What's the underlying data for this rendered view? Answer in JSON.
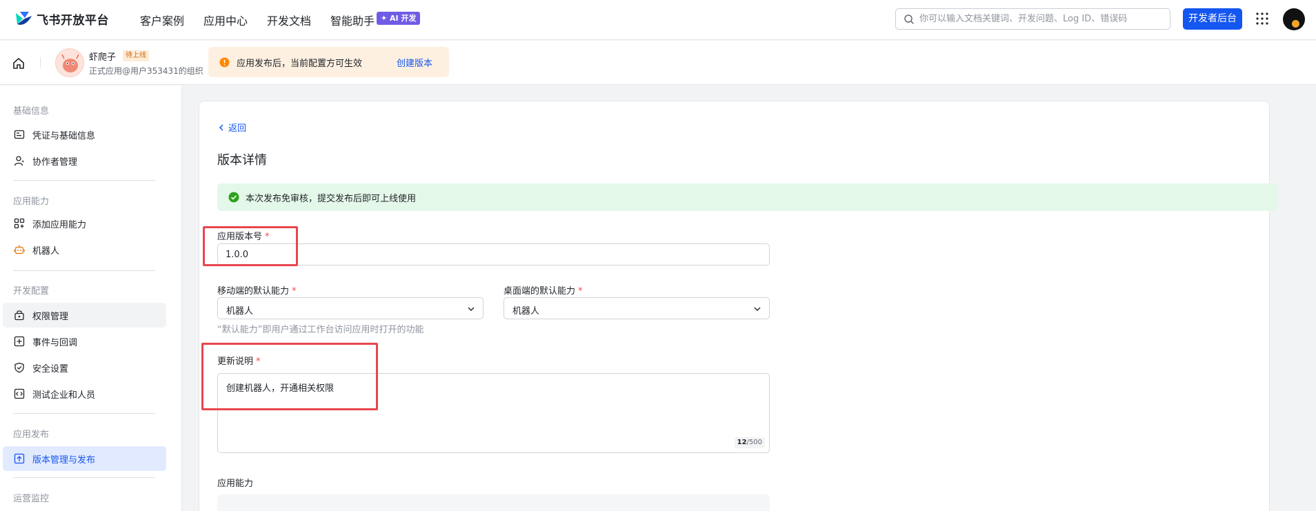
{
  "brand": {
    "name": "飞书开放平台"
  },
  "topnav": {
    "items": [
      {
        "label": "客户案例"
      },
      {
        "label": "应用中心"
      },
      {
        "label": "开发文档"
      },
      {
        "label": "智能助手"
      }
    ],
    "ai_badge": "✦ AI 开发",
    "search_placeholder": "你可以输入文档关键词、开发问题、Log ID、错误码",
    "dev_console_label": "开发者后台"
  },
  "app": {
    "name": "虾爬子",
    "status_badge": "待上线",
    "org": "正式应用@用户353431的组织"
  },
  "notice": {
    "text": "应用发布后，当前配置方可生效",
    "link": "创建版本"
  },
  "sidebar": {
    "groups": [
      {
        "title": "基础信息",
        "items": [
          {
            "label": "凭证与基础信息"
          },
          {
            "label": "协作者管理"
          }
        ]
      },
      {
        "title": "应用能力",
        "items": [
          {
            "label": "添加应用能力"
          },
          {
            "label": "机器人"
          }
        ]
      },
      {
        "title": "开发配置",
        "items": [
          {
            "label": "权限管理"
          },
          {
            "label": "事件与回调"
          },
          {
            "label": "安全设置"
          },
          {
            "label": "测试企业和人员"
          }
        ]
      },
      {
        "title": "应用发布",
        "items": [
          {
            "label": "版本管理与发布"
          }
        ]
      },
      {
        "title": "运营监控",
        "items": []
      }
    ],
    "active_item": "版本管理与发布"
  },
  "main": {
    "back_label": "返回",
    "title": "版本详情",
    "success_message": "本次发布免审核，提交发布后即可上线使用",
    "version_label": "应用版本号",
    "version_value": "1.0.0",
    "mobile_default_label": "移动端的默认能力",
    "mobile_default_value": "机器人",
    "desktop_default_label": "桌面端的默认能力",
    "desktop_default_value": "机器人",
    "default_hint": "“默认能力”即用户通过工作台访问应用时打开的功能",
    "changelog_label": "更新说明",
    "changelog_value": "创建机器人，开通相关权限",
    "changelog_count": "12",
    "changelog_max": "/500",
    "capabilities_label": "应用能力",
    "required_mark": "*"
  },
  "colors": {
    "primary": "#1456f0",
    "highlight": "#e7464e",
    "success_bg": "#e4f8e9",
    "notice_bg": "#fef0e1"
  }
}
